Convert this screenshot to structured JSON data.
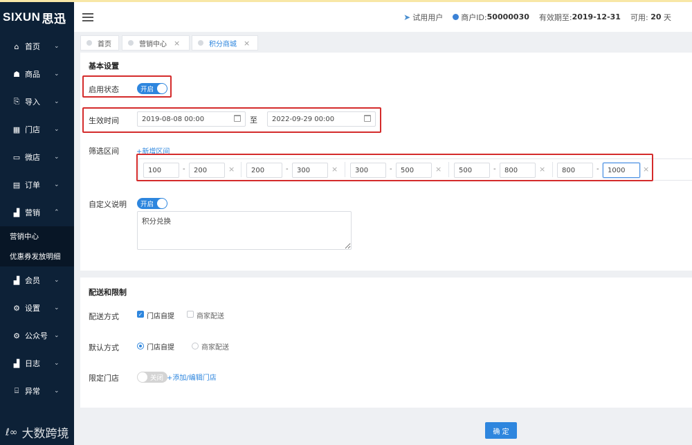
{
  "brand": {
    "logo_latin": "SIXUN",
    "logo_cn": "思迅"
  },
  "sidebar": {
    "items": [
      {
        "label": "首页",
        "icon": "home-icon",
        "glyph": "⌂",
        "chevron": "⌄"
      },
      {
        "label": "商品",
        "icon": "goods-icon",
        "glyph": "☗",
        "chevron": "⌄"
      },
      {
        "label": "导入",
        "icon": "import-icon",
        "glyph": "⎘",
        "chevron": "⌄"
      },
      {
        "label": "门店",
        "icon": "store-icon",
        "glyph": "▦",
        "chevron": "⌄"
      },
      {
        "label": "微店",
        "icon": "microstore-icon",
        "glyph": "▭",
        "chevron": "⌄"
      },
      {
        "label": "订单",
        "icon": "order-icon",
        "glyph": "▤",
        "chevron": "⌄"
      },
      {
        "label": "营销",
        "icon": "marketing-icon",
        "glyph": "▟",
        "chevron": "⌃"
      }
    ],
    "sub_items": [
      "营销中心",
      "优惠券发放明细"
    ],
    "items_after": [
      {
        "label": "会员",
        "icon": "member-icon",
        "glyph": "▟",
        "chevron": "⌄"
      },
      {
        "label": "设置",
        "icon": "gear-icon",
        "glyph": "⚙",
        "chevron": "⌄"
      },
      {
        "label": "公众号",
        "icon": "public-account-icon",
        "glyph": "⚙",
        "chevron": "⌄"
      },
      {
        "label": "日志",
        "icon": "log-icon",
        "glyph": "▟",
        "chevron": "⌄"
      },
      {
        "label": "异常",
        "icon": "gift-icon",
        "glyph": "⌸",
        "chevron": "⌄"
      }
    ]
  },
  "header": {
    "trial_user": "试用用户",
    "merchant_id_label": "商户ID:",
    "merchant_id": "50000030",
    "valid_until_label": "有效期至:",
    "valid_until": "2019-12-31",
    "available_label": "可用:",
    "available_days": "20",
    "days_unit": "天"
  },
  "tabs": [
    {
      "label": "首页",
      "closable": false
    },
    {
      "label": "营销中心",
      "closable": true,
      "close": "×"
    },
    {
      "label": "积分商城",
      "closable": true,
      "close": "×",
      "active": true
    }
  ],
  "basic": {
    "section_title": "基本设置",
    "enable_label": "启用状态",
    "enable_toggle": "开启",
    "effective_label": "生效时间",
    "start_time": "2019-08-08 00:00",
    "to_text": "至",
    "end_time": "2022-09-29 00:00",
    "range_label": "筛选区间",
    "add_range": "+新增区间",
    "ranges": [
      {
        "from": "100",
        "to": "200"
      },
      {
        "from": "200",
        "to": "300"
      },
      {
        "from": "300",
        "to": "500"
      },
      {
        "from": "500",
        "to": "800"
      },
      {
        "from": "800",
        "to": "1000"
      }
    ],
    "dash": "-",
    "remove": "×",
    "custom_label": "自定义说明",
    "custom_toggle": "开启",
    "custom_text": "积分兑换"
  },
  "delivery": {
    "section_title": "配送和限制",
    "method_label": "配送方式",
    "method_opt1": "门店自提",
    "method_opt2": "商家配送",
    "default_label": "默认方式",
    "default_opt1": "门店自提",
    "default_opt2": "商家配送",
    "limit_label": "限定门店",
    "limit_toggle": "关闭",
    "add_store": "+添加/编辑门店"
  },
  "confirm_label": "确 定",
  "watermark": "大数跨境",
  "watermark_glyph": "ℓ∞",
  "colors": {
    "sidebar_bg": "#0d2137",
    "accent": "#2e86de",
    "highlight_red": "#d42b2b"
  }
}
